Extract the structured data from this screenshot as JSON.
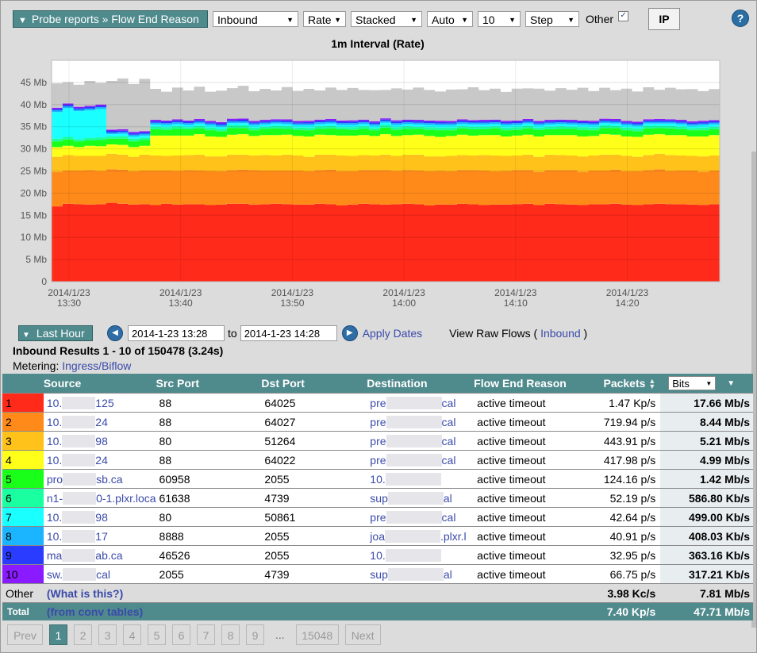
{
  "toolbar": {
    "report_title": "Probe reports » Flow End Reason",
    "direction": "Inbound",
    "metric": "Rate",
    "mode": "Stacked",
    "scale": "Auto",
    "count": "10",
    "interp": "Step",
    "other_label": "Other",
    "other_checked": "✓",
    "ip_label": "IP",
    "help_label": "?"
  },
  "chart": {
    "title": "1m Interval (Rate)"
  },
  "chart_data": {
    "type": "area",
    "stacked": true,
    "title": "1m Interval (Rate)",
    "y_ticks": [
      "0",
      "5 Mb",
      "10 Mb",
      "15 Mb",
      "20 Mb",
      "25 Mb",
      "30 Mb",
      "35 Mb",
      "40 Mb",
      "45 Mb"
    ],
    "ylim": [
      0,
      50
    ],
    "x_ticks": [
      {
        "date": "2014/1/23",
        "time": "13:30"
      },
      {
        "date": "2014/1/23",
        "time": "13:40"
      },
      {
        "date": "2014/1/23",
        "time": "13:50"
      },
      {
        "date": "2014/1/23",
        "time": "14:00"
      },
      {
        "date": "2014/1/23",
        "time": "14:10"
      },
      {
        "date": "2014/1/23",
        "time": "14:20"
      }
    ],
    "xlim": [
      "2014-01-23 13:28",
      "2014-01-23 14:28"
    ],
    "grid": true,
    "series": [
      {
        "color": "#ff2a1a",
        "values": [
          17.0,
          17.6,
          17.5,
          17.4,
          17.5,
          17.8,
          17.6,
          17.4,
          17.5,
          17.3,
          17.6,
          17.4,
          17.5,
          17.5,
          17.3,
          17.4,
          17.6,
          17.6,
          17.4,
          17.5,
          17.6,
          17.5,
          17.4,
          17.4,
          17.6,
          17.5,
          17.2,
          17.4,
          17.6,
          17.5,
          17.4,
          17.5,
          17.6,
          17.5,
          17.2,
          17.4,
          17.4,
          17.6,
          17.5,
          17.3,
          17.4,
          17.4,
          17.5,
          17.6,
          17.3,
          17.6,
          17.5,
          17.4,
          17.3,
          17.5,
          17.5,
          17.6,
          17.4,
          17.3,
          17.5,
          17.6,
          17.5,
          17.5,
          17.4,
          17.3,
          17.5
        ]
      },
      {
        "color": "#ff8a1a",
        "values": [
          7.8,
          7.5,
          7.6,
          7.8,
          7.5,
          7.6,
          7.7,
          7.5,
          7.6,
          7.8,
          7.5,
          7.6,
          7.7,
          7.6,
          7.7,
          7.5,
          7.6,
          7.7,
          7.8,
          7.6,
          7.5,
          7.6,
          7.7,
          7.5,
          7.6,
          7.8,
          7.7,
          7.5,
          7.6,
          7.7,
          7.8,
          7.5,
          7.6,
          7.6,
          7.7,
          7.6,
          7.5,
          7.6,
          7.7,
          7.8,
          7.5,
          7.6,
          7.7,
          7.6,
          7.5,
          7.6,
          7.7,
          7.8,
          7.5,
          7.6,
          7.6,
          7.7,
          7.5,
          7.6,
          7.7,
          7.8,
          7.5,
          7.6,
          7.7,
          7.5,
          7.6
        ]
      },
      {
        "color": "#ffc21a",
        "values": [
          3.4,
          3.5,
          3.3,
          3.2,
          3.4,
          3.5,
          3.4,
          3.3,
          3.6,
          3.4,
          3.3,
          3.5,
          3.4,
          3.6,
          3.3,
          3.4,
          3.5,
          3.4,
          3.3,
          3.5,
          3.4,
          3.6,
          3.4,
          3.3,
          3.5,
          3.4,
          3.6,
          3.5,
          3.4,
          3.3,
          3.5,
          3.4,
          3.5,
          3.6,
          3.4,
          3.3,
          3.5,
          3.4,
          3.3,
          3.5,
          3.6,
          3.4,
          3.3,
          3.5,
          3.4,
          3.5,
          3.4,
          3.3,
          3.5,
          3.4,
          3.6,
          3.4,
          3.5,
          3.3,
          3.4,
          3.5,
          3.6,
          3.4,
          3.3,
          3.5,
          3.4
        ]
      },
      {
        "color": "#ffff1a",
        "values": [
          2.2,
          2.1,
          2.0,
          2.3,
          2.2,
          2.1,
          2.2,
          2.2,
          2.0,
          4.5,
          4.6,
          4.5,
          4.4,
          4.6,
          4.5,
          4.4,
          4.5,
          4.6,
          4.4,
          4.5,
          4.6,
          4.5,
          4.4,
          4.6,
          4.5,
          4.4,
          4.5,
          4.6,
          4.5,
          4.4,
          4.6,
          4.5,
          4.4,
          4.5,
          4.6,
          4.4,
          4.5,
          4.6,
          4.5,
          4.5,
          4.6,
          4.4,
          4.5,
          4.5,
          4.6,
          4.4,
          4.5,
          4.6,
          4.5,
          4.4,
          4.6,
          4.5,
          4.4,
          4.5,
          4.6,
          4.4,
          4.5,
          4.6,
          4.4,
          4.5,
          4.6
        ]
      },
      {
        "color": "#1aff1a",
        "values": [
          1.3,
          1.4,
          1.3,
          1.2,
          1.4,
          1.3,
          1.4,
          1.3,
          1.3,
          1.4,
          1.3,
          1.5,
          1.4,
          1.3,
          1.4,
          1.3,
          1.5,
          1.4,
          1.3,
          1.4,
          1.5,
          1.3,
          1.4,
          1.4,
          1.3,
          1.5,
          1.4,
          1.3,
          1.4,
          1.3,
          1.5,
          1.4,
          1.4,
          1.3,
          1.4,
          1.5,
          1.3,
          1.4,
          1.4,
          1.3,
          1.5,
          1.4,
          1.3,
          1.4,
          1.5,
          1.3,
          1.4,
          1.4,
          1.5,
          1.3,
          1.4,
          1.5,
          1.4,
          1.3,
          1.4,
          1.4,
          1.5,
          1.3,
          1.4,
          1.4,
          1.3
        ]
      },
      {
        "color": "#1affa0",
        "values": [
          0.6,
          0.6,
          0.5,
          0.6,
          0.6,
          0.5,
          0.6,
          0.6,
          0.5,
          0.6,
          0.6,
          0.6,
          0.5,
          0.6,
          0.6,
          0.5,
          0.6,
          0.6,
          0.6,
          0.5,
          0.6,
          0.6,
          0.5,
          0.6,
          0.6,
          0.6,
          0.5,
          0.6,
          0.6,
          0.5,
          0.6,
          0.6,
          0.6,
          0.5,
          0.6,
          0.6,
          0.6,
          0.5,
          0.6,
          0.6,
          0.5,
          0.6,
          0.6,
          0.6,
          0.5,
          0.6,
          0.6,
          0.5,
          0.6,
          0.6,
          0.6,
          0.5,
          0.6,
          0.6,
          0.6,
          0.5,
          0.6,
          0.6,
          0.5,
          0.6,
          0.6
        ]
      },
      {
        "color": "#1affff",
        "values": [
          6.0,
          6.5,
          6.3,
          6.2,
          6.4,
          0.5,
          0.5,
          0.5,
          0.5,
          0.5,
          0.5,
          0.5,
          0.5,
          0.5,
          0.5,
          0.5,
          0.5,
          0.5,
          0.5,
          0.5,
          0.5,
          0.5,
          0.5,
          0.5,
          0.5,
          0.5,
          0.5,
          0.5,
          0.5,
          0.5,
          0.5,
          0.5,
          0.5,
          0.5,
          0.5,
          0.5,
          0.5,
          0.5,
          0.5,
          0.5,
          0.5,
          0.5,
          0.5,
          0.5,
          0.5,
          0.5,
          0.5,
          0.5,
          0.5,
          0.5,
          0.5,
          0.5,
          0.5,
          0.5,
          0.5,
          0.5,
          0.5,
          0.5,
          0.5,
          0.5,
          0.5
        ]
      },
      {
        "color": "#1ab4ff",
        "values": [
          0.4,
          0.4,
          0.4,
          0.4,
          0.4,
          0.4,
          0.4,
          0.4,
          0.4,
          0.4,
          0.4,
          0.4,
          0.4,
          0.4,
          0.4,
          0.4,
          0.4,
          0.4,
          0.4,
          0.4,
          0.4,
          0.4,
          0.4,
          0.4,
          0.4,
          0.4,
          0.4,
          0.4,
          0.4,
          0.4,
          0.4,
          0.4,
          0.4,
          0.4,
          0.4,
          0.4,
          0.4,
          0.4,
          0.4,
          0.4,
          0.4,
          0.4,
          0.4,
          0.4,
          0.4,
          0.4,
          0.4,
          0.4,
          0.4,
          0.4,
          0.4,
          0.4,
          0.4,
          0.4,
          0.4,
          0.4,
          0.4,
          0.4,
          0.4,
          0.4,
          0.4
        ]
      },
      {
        "color": "#2a3cff",
        "values": [
          0.3,
          0.35,
          0.3,
          0.35,
          0.3,
          0.35,
          0.3,
          0.35,
          0.3,
          0.35,
          0.3,
          0.35,
          0.3,
          0.35,
          0.3,
          0.35,
          0.3,
          0.35,
          0.3,
          0.35,
          0.3,
          0.35,
          0.3,
          0.35,
          0.3,
          0.35,
          0.3,
          0.35,
          0.3,
          0.35,
          0.3,
          0.35,
          0.3,
          0.35,
          0.3,
          0.35,
          0.3,
          0.35,
          0.3,
          0.35,
          0.3,
          0.35,
          0.3,
          0.35,
          0.3,
          0.35,
          0.3,
          0.35,
          0.3,
          0.35,
          0.3,
          0.35,
          0.3,
          0.35,
          0.3,
          0.35,
          0.3,
          0.35,
          0.3,
          0.35,
          0.3
        ]
      },
      {
        "color": "#8a1aff",
        "values": [
          0.3,
          0.3,
          0.3,
          0.3,
          0.3,
          0.3,
          0.3,
          0.3,
          0.3,
          0.3,
          0.3,
          0.3,
          0.3,
          0.3,
          0.3,
          0.3,
          0.3,
          0.3,
          0.3,
          0.3,
          0.3,
          0.3,
          0.3,
          0.3,
          0.3,
          0.3,
          0.3,
          0.3,
          0.3,
          0.3,
          0.3,
          0.3,
          0.3,
          0.3,
          0.3,
          0.3,
          0.3,
          0.3,
          0.3,
          0.3,
          0.3,
          0.3,
          0.3,
          0.3,
          0.3,
          0.3,
          0.3,
          0.3,
          0.3,
          0.3,
          0.3,
          0.3,
          0.3,
          0.3,
          0.3,
          0.3,
          0.3,
          0.3,
          0.3,
          0.3,
          0.3
        ]
      },
      {
        "color": "#c8c8c8",
        "values": [
          5.5,
          4.8,
          5.0,
          5.6,
          4.9,
          11.0,
          11.5,
          10.8,
          11.8,
          7.0,
          6.5,
          7.2,
          6.8,
          7.3,
          6.6,
          7.1,
          6.9,
          7.4,
          6.7,
          7.0,
          6.5,
          7.3,
          6.8,
          7.2,
          6.6,
          7.1,
          6.9,
          7.3,
          6.7,
          7.0,
          6.4,
          7.2,
          6.8,
          7.3,
          6.9,
          6.6,
          7.1,
          6.8,
          7.4,
          6.7,
          7.0,
          6.5,
          7.2,
          6.9,
          7.3,
          6.6,
          7.1,
          6.8,
          7.4,
          6.7,
          7.0,
          6.5,
          7.3,
          6.8,
          7.2,
          6.6,
          7.1,
          6.9,
          7.3,
          6.7,
          7.0
        ]
      }
    ]
  },
  "datebar": {
    "range_label": "Last Hour",
    "prev_icon": "◀",
    "next_icon": "▶",
    "from": "2014-1-23 13:28",
    "to_label": "to",
    "to": "2014-1-23 14:28",
    "apply_label": "Apply Dates",
    "raw_prefix": "View Raw Flows ( ",
    "raw_link": "Inbound",
    "raw_suffix": " )"
  },
  "results": {
    "title": "Inbound Results 1 - 10 of 150478 (3.24s)",
    "metering_label": "Metering: ",
    "metering_value": "Ingress/Biflow"
  },
  "table": {
    "headers": {
      "source": "Source",
      "src_port": "Src Port",
      "dst_port": "Dst Port",
      "destination": "Destination",
      "reason": "Flow End Reason",
      "packets": "Packets",
      "bits": "Bits"
    },
    "rows": [
      {
        "n": "1",
        "color": "#ff2a1a",
        "src_a": "10.",
        "src_b": "125",
        "src_port": "88",
        "dst_port": "64025",
        "dst_a": "pre",
        "dst_b": "cal",
        "reason": "active timeout",
        "packets": "1.47 Kp/s",
        "bits": "17.66 Mb/s"
      },
      {
        "n": "2",
        "color": "#ff8a1a",
        "src_a": "10.",
        "src_b": "24",
        "src_port": "88",
        "dst_port": "64027",
        "dst_a": "pre",
        "dst_b": "cal",
        "reason": "active timeout",
        "packets": "719.94 p/s",
        "bits": "8.44 Mb/s"
      },
      {
        "n": "3",
        "color": "#ffc21a",
        "src_a": "10.",
        "src_b": "98",
        "src_port": "80",
        "dst_port": "51264",
        "dst_a": "pre",
        "dst_b": "cal",
        "reason": "active timeout",
        "packets": "443.91 p/s",
        "bits": "5.21 Mb/s"
      },
      {
        "n": "4",
        "color": "#ffff1a",
        "src_a": "10.",
        "src_b": "24",
        "src_port": "88",
        "dst_port": "64022",
        "dst_a": "pre",
        "dst_b": "cal",
        "reason": "active timeout",
        "packets": "417.98 p/s",
        "bits": "4.99 Mb/s"
      },
      {
        "n": "5",
        "color": "#1aff1a",
        "src_a": "pro",
        "src_b": "sb.ca",
        "src_port": "60958",
        "dst_port": "2055",
        "dst_a": "10.",
        "dst_b": "",
        "reason": "active timeout",
        "packets": "124.16 p/s",
        "bits": "1.42 Mb/s"
      },
      {
        "n": "6",
        "color": "#1affa0",
        "src_a": "n1-",
        "src_b": "0-1.plxr.loca",
        "src_port": "61638",
        "dst_port": "4739",
        "dst_a": "sup",
        "dst_b": "al",
        "reason": "active timeout",
        "packets": "52.19 p/s",
        "bits": "586.80 Kb/s"
      },
      {
        "n": "7",
        "color": "#1affff",
        "src_a": "10.",
        "src_b": "98",
        "src_port": "80",
        "dst_port": "50861",
        "dst_a": "pre",
        "dst_b": "cal",
        "reason": "active timeout",
        "packets": "42.64 p/s",
        "bits": "499.00 Kb/s"
      },
      {
        "n": "8",
        "color": "#1ab4ff",
        "src_a": "10.",
        "src_b": "17",
        "src_port": "8888",
        "dst_port": "2055",
        "dst_a": "joa",
        "dst_b": ".plxr.l",
        "reason": "active timeout",
        "packets": "40.91 p/s",
        "bits": "408.03 Kb/s"
      },
      {
        "n": "9",
        "color": "#2a3cff",
        "src_a": "ma",
        "src_b": "ab.ca",
        "src_port": "46526",
        "dst_port": "2055",
        "dst_a": "10.",
        "dst_b": "",
        "reason": "active timeout",
        "packets": "32.95 p/s",
        "bits": "363.16 Kb/s"
      },
      {
        "n": "10",
        "color": "#8a1aff",
        "src_a": "sw.",
        "src_b": "cal",
        "src_port": "2055",
        "dst_port": "4739",
        "dst_a": "sup",
        "dst_b": "al",
        "reason": "active timeout",
        "packets": "66.75 p/s",
        "bits": "317.21 Kb/s"
      }
    ],
    "other": {
      "label": "Other",
      "link": "(What is this?)",
      "packets": "3.98 Kc/s",
      "bits": "7.81 Mb/s"
    },
    "total": {
      "label": "Total",
      "link": "(from conv tables)",
      "packets": "7.40 Kp/s",
      "bits": "47.71 Mb/s"
    }
  },
  "pager": {
    "prev": "Prev",
    "pages": [
      "1",
      "2",
      "3",
      "4",
      "5",
      "6",
      "7",
      "8",
      "9"
    ],
    "ellipsis": "...",
    "last": "15048",
    "next": "Next"
  }
}
